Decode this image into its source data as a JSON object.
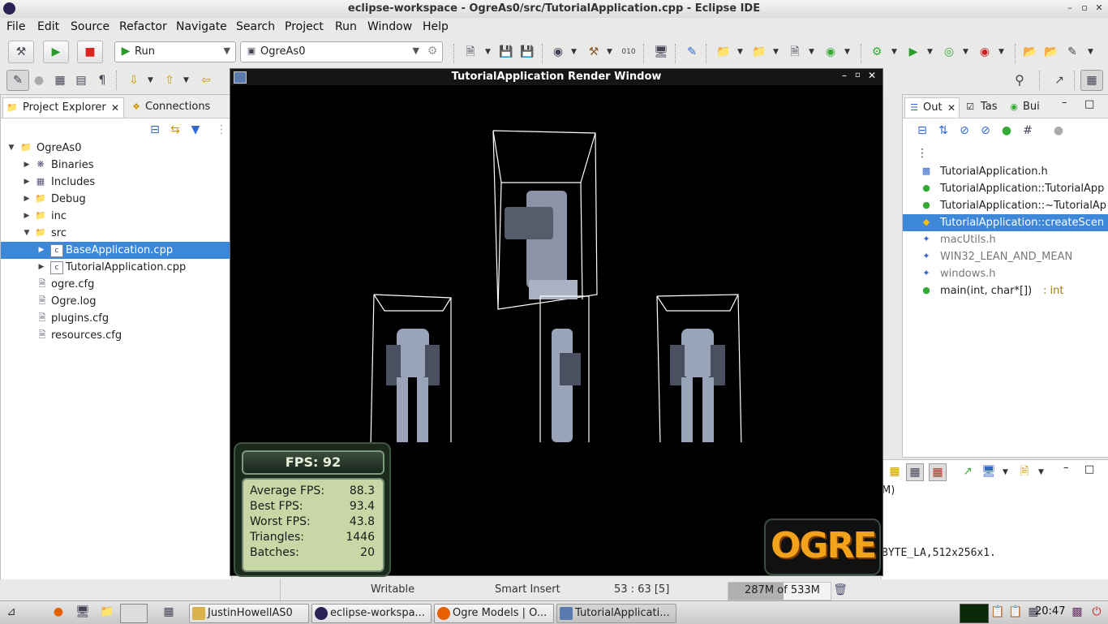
{
  "window": {
    "title": "eclipse-workspace - OgreAs0/src/TutorialApplication.cpp - Eclipse IDE"
  },
  "menu": [
    "File",
    "Edit",
    "Source",
    "Refactor",
    "Navigate",
    "Search",
    "Project",
    "Run",
    "Window",
    "Help"
  ],
  "toolbar": {
    "launch_mode": "Run",
    "launch_config": "OgreAs0"
  },
  "project_explorer": {
    "tab_label": "Project Explorer",
    "tab2_label": "Connections",
    "items": [
      {
        "label": "OgreAs0",
        "icon": "project-icon"
      },
      {
        "label": "Binaries",
        "icon": "binaries-icon"
      },
      {
        "label": "Includes",
        "icon": "includes-icon"
      },
      {
        "label": "Debug",
        "icon": "folder-icon"
      },
      {
        "label": "inc",
        "icon": "folder-icon"
      },
      {
        "label": "src",
        "icon": "folder-icon"
      },
      {
        "label": "BaseApplication.cpp",
        "icon": "cpp-file-icon"
      },
      {
        "label": "TutorialApplication.cpp",
        "icon": "cpp-file-icon"
      },
      {
        "label": "ogre.cfg",
        "icon": "text-file-icon"
      },
      {
        "label": "Ogre.log",
        "icon": "text-file-icon"
      },
      {
        "label": "plugins.cfg",
        "icon": "text-file-icon"
      },
      {
        "label": "resources.cfg",
        "icon": "text-file-icon"
      }
    ]
  },
  "render_window": {
    "title": "TutorialApplication Render Window",
    "fps_label": "FPS: 92",
    "stats": [
      {
        "label": "Average FPS:",
        "value": "88.3"
      },
      {
        "label": "Best FPS:",
        "value": "93.4"
      },
      {
        "label": "Worst FPS:",
        "value": "43.8"
      },
      {
        "label": "Triangles:",
        "value": "1446"
      },
      {
        "label": "Batches:",
        "value": "20"
      }
    ],
    "logo_text": "OGRE"
  },
  "outline": {
    "tabs": [
      "Out",
      "Tas",
      "Bui"
    ],
    "items": [
      {
        "label": "TutorialApplication.h",
        "detail": "",
        "icon": "include-icon"
      },
      {
        "label": "TutorialApplication::TutorialApp",
        "detail": "",
        "icon": "method-icon"
      },
      {
        "label": "TutorialApplication::~TutorialAp",
        "detail": "",
        "icon": "method-icon"
      },
      {
        "label": "TutorialApplication::createScen",
        "detail": "",
        "icon": "method-protected-icon"
      },
      {
        "label": "macUtils.h",
        "detail": "",
        "icon": "macro-icon"
      },
      {
        "label": "WIN32_LEAN_AND_MEAN",
        "detail": "",
        "icon": "macro-icon"
      },
      {
        "label": "windows.h",
        "detail": "",
        "icon": "macro-icon"
      },
      {
        "label": "main(int, char*[])",
        "detail": " : int",
        "icon": "function-icon"
      }
    ]
  },
  "console": {
    "header_fragment": "M)",
    "line": "BYTE_LA,512x256x1."
  },
  "status": {
    "writable": "Writable",
    "insert_mode": "Smart Insert",
    "position": "53 : 63 [5]",
    "heap": "287M of 533M",
    "heap_used_fraction": 0.54
  },
  "taskbar": {
    "tasks": [
      "JustinHowellAS0",
      "eclipse-workspa...",
      "Ogre Models | O...",
      "TutorialApplicati..."
    ],
    "clock": "20:47"
  }
}
